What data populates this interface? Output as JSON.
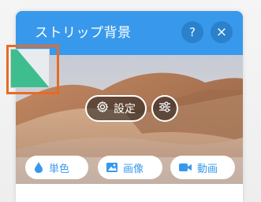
{
  "panel": {
    "title": "ストリップ背景",
    "help_label": "?",
    "close_label": "×"
  },
  "preview": {
    "settings_label": "設定"
  },
  "media_buttons": [
    {
      "label": "単色",
      "icon": "droplet-icon"
    },
    {
      "label": "画像",
      "icon": "image-icon"
    },
    {
      "label": "動画",
      "icon": "video-camera-icon"
    }
  ],
  "colors": {
    "header": "#3899ec",
    "accent": "#3899ec",
    "swatch_green": "#3ebd8f",
    "highlight": "#e86a25"
  }
}
